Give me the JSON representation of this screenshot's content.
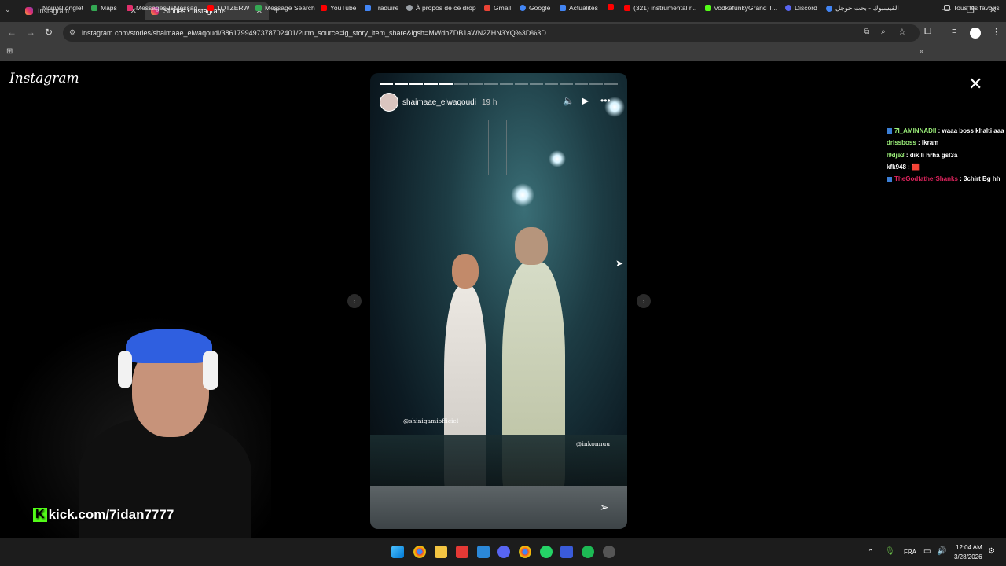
{
  "browser": {
    "tabs": [
      {
        "label": "Instagram"
      },
      {
        "label": "Stories • Instagram"
      }
    ],
    "url": "instagram.com/stories/shaimaae_elwaqoudi/3861799497378702401/?utm_source=ig_story_item_share&igsh=MWdhZDB1aWN2ZHN3YQ%3D%3D",
    "bookmarks": [
      {
        "label": "Nouvel onglet",
        "color": "#8ab4f8"
      },
      {
        "label": "Maps",
        "color": "#34a853"
      },
      {
        "label": "Messages9+Messag...",
        "color": "#e1306c"
      },
      {
        "label": "1QTZERW",
        "color": "#ff0000"
      },
      {
        "label": "Message Search",
        "color": "#34a853"
      },
      {
        "label": "YouTube",
        "color": "#ff0000"
      },
      {
        "label": "Traduire",
        "color": "#4285f4"
      },
      {
        "label": "À propos de ce drop",
        "color": "#9aa0a6"
      },
      {
        "label": "Gmail",
        "color": "#ea4335"
      },
      {
        "label": "Google",
        "color": "#4285f4"
      },
      {
        "label": "Actualités",
        "color": "#4285f4"
      },
      {
        "label": "",
        "color": "#ff0000"
      },
      {
        "label": "(321) instrumental r...",
        "color": "#ff0000"
      },
      {
        "label": "vodkafunkyGrand T...",
        "color": "#53fc18"
      },
      {
        "label": "Discord",
        "color": "#5865f2"
      },
      {
        "label": "الفيسبوك - بحث جوجل",
        "color": "#4285f4"
      }
    ],
    "all_bookmarks": "Tous les favoris"
  },
  "instagram": {
    "logo": "Instagram",
    "story": {
      "username": "shaimaae_elwaqoudi",
      "time": "19 h",
      "segments_total": 16,
      "segments_done": 5,
      "tag_left": "@shinigamiofficiel",
      "tag_right": "@inkonnuu"
    }
  },
  "stream": {
    "kick_url": "kick.com/7idan7777",
    "chat": [
      {
        "user": "7I_AMINNADII",
        "user_color": "#9cf07a",
        "message": "waaa boss khalti aaa"
      },
      {
        "user": "drissboss",
        "user_color": "#9cf07a",
        "message": "ikram"
      },
      {
        "user": "l9dje3",
        "user_color": "#9cf07a",
        "message": "dik li hrha gsl3a"
      },
      {
        "user": "kfk948",
        "user_color": "#ffffff",
        "message": "🟥"
      },
      {
        "user": "TheGodfatherShanks",
        "user_color": "#e0245e",
        "message": "3chirt Bg hh"
      }
    ]
  },
  "taskbar": {
    "language": "FRA",
    "time": "12:04 AM",
    "date": "3/28/2026"
  }
}
